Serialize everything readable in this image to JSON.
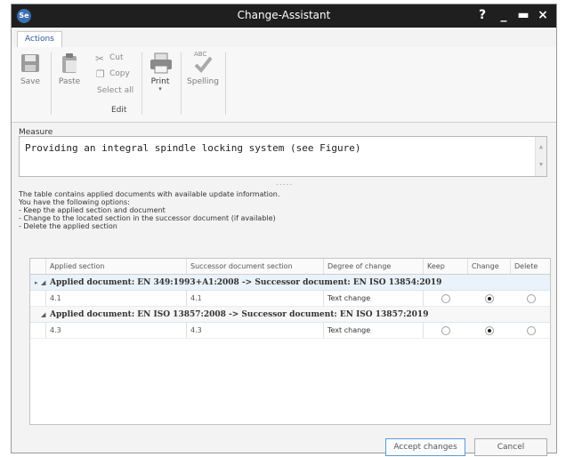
{
  "window": {
    "title": "Change-Assistant",
    "app_icon": "Se"
  },
  "titlebar_buttons": {
    "help": "?",
    "minimize": "_",
    "maximize": "▬",
    "close": "×"
  },
  "tabs": [
    {
      "label": "Actions",
      "active": true
    }
  ],
  "ribbon": {
    "save": "Save",
    "paste": "Paste",
    "cut": "Cut",
    "copy": "Copy",
    "select_all": "Select all",
    "edit_group": "Edit",
    "print": "Print",
    "spelling": "Spelling",
    "spelling_badge": "ABC"
  },
  "measure": {
    "label": "Measure",
    "value": "Providing an integral spindle locking system (see Figure)",
    "splitter": "....."
  },
  "info_lines": [
    "The table contains applied documents with available update information.",
    "You have the following options:",
    "- Keep the applied section and document",
    "- Change to the located section in the successor document (if available)",
    "- Delete the applied section"
  ],
  "table": {
    "columns": [
      "Applied section",
      "Successor document section",
      "Degree of change",
      "Keep",
      "Change",
      "Delete"
    ],
    "groups": [
      {
        "title": "Applied document: EN 349:1993+A1:2008 -> Successor document: EN ISO 13854:2019",
        "rows": [
          {
            "applied": "4.1",
            "successor": "4.1",
            "degree": "Text change",
            "selection": "change"
          }
        ]
      },
      {
        "title": "Applied document: EN ISO 13857:2008 -> Successor document: EN ISO 13857:2019",
        "rows": [
          {
            "applied": "4.3",
            "successor": "4.3",
            "degree": "Text change",
            "selection": "change"
          }
        ]
      }
    ]
  },
  "buttons": {
    "accept": "Accept changes",
    "cancel": "Cancel"
  },
  "colors": {
    "titlebar": "#1f1f1f",
    "accent": "#2b579a",
    "group_row": "#eaf2fb"
  }
}
